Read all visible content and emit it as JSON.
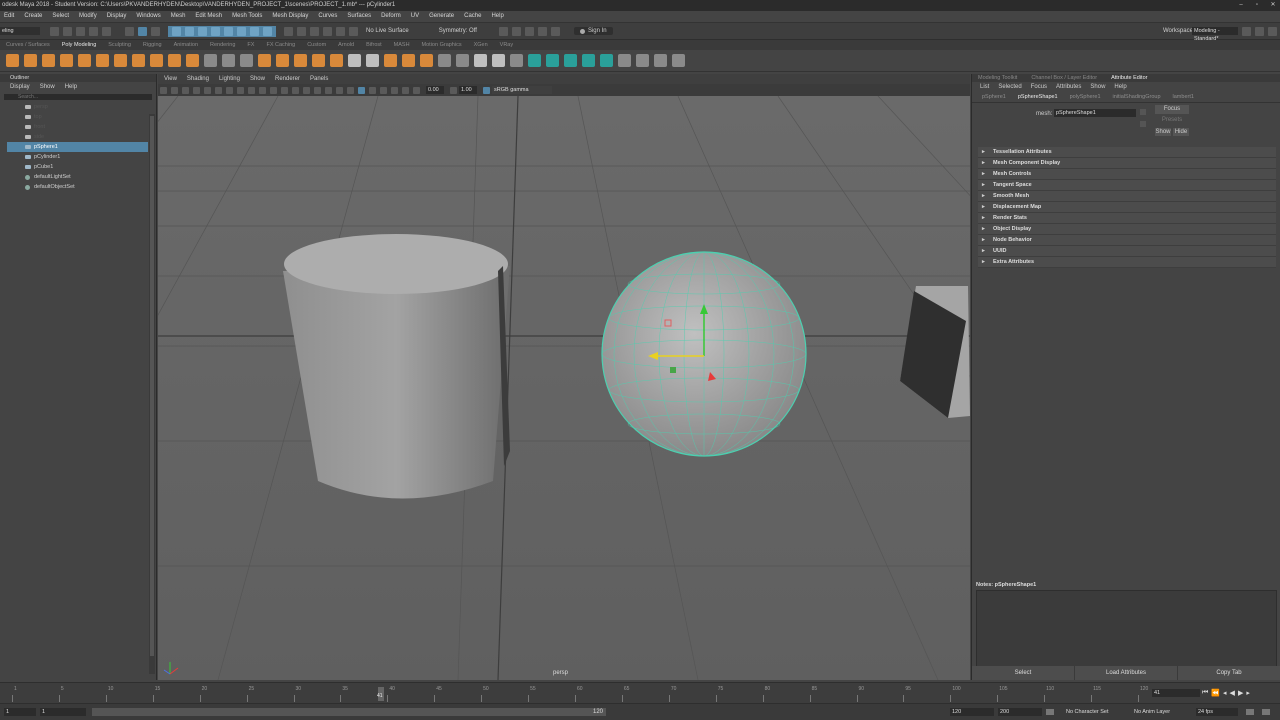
{
  "window": {
    "title": "odesk Maya 2018 - Student Version: C:\\Users\\PKVANDERHYDEN\\Desktop\\VANDERHYDEN_PROJECT_1\\scenes\\PROJECT_1.mb* --- pCylinder1"
  },
  "menubar": [
    "Edit",
    "Create",
    "Select",
    "Modify",
    "Display",
    "Windows",
    "Mesh",
    "Edit Mesh",
    "Mesh Tools",
    "Mesh Display",
    "Curves",
    "Surfaces",
    "Deform",
    "UV",
    "Generate",
    "Cache",
    "Help"
  ],
  "statusline": {
    "mode": "eling",
    "live_surface": "No Live Surface",
    "symmetry": "Symmetry: Off",
    "sign_in": "Sign In",
    "workspace_label": "Workspace:",
    "workspace_value": "Modeling - Standard*"
  },
  "shelf_tabs": [
    "Curves / Surfaces",
    "Poly Modeling",
    "Sculpting",
    "Rigging",
    "Animation",
    "Rendering",
    "FX",
    "FX Caching",
    "Custom",
    "Arnold",
    "Bifrost",
    "MASH",
    "Motion Graphics",
    "XGen",
    "VRay"
  ],
  "shelf_active": "Poly Modeling",
  "outliner": {
    "title": "Outliner",
    "menu": [
      "Display",
      "Show",
      "Help"
    ],
    "search_placeholder": "Search...",
    "items": [
      {
        "label": "persp",
        "type": "camera"
      },
      {
        "label": "top",
        "type": "camera"
      },
      {
        "label": "front",
        "type": "camera"
      },
      {
        "label": "side",
        "type": "camera"
      },
      {
        "label": "pSphere1",
        "type": "mesh",
        "selected": true
      },
      {
        "label": "pCylinder1",
        "type": "mesh"
      },
      {
        "label": "pCube1",
        "type": "mesh"
      },
      {
        "label": "defaultLightSet",
        "type": "set"
      },
      {
        "label": "defaultObjectSet",
        "type": "set"
      }
    ]
  },
  "viewport": {
    "menu": [
      "View",
      "Shading",
      "Lighting",
      "Show",
      "Renderer",
      "Panels"
    ],
    "field1": "0.00",
    "field2": "1.00",
    "color_space": "sRGB gamma",
    "camera_label": "persp"
  },
  "attribute_editor": {
    "top_tabs": [
      "Modeling Toolkit",
      "Channel Box / Layer Editor",
      "Attribute Editor"
    ],
    "active_tab": "Attribute Editor",
    "menu": [
      "List",
      "Selected",
      "Focus",
      "Attributes",
      "Show",
      "Help"
    ],
    "node_tabs": [
      "pSphere1",
      "pSphereShape1",
      "polySphere1",
      "initialShadingGroup",
      "lambert1"
    ],
    "active_node_tab": "pSphereShape1",
    "mesh_label": "mesh:",
    "mesh_value": "pSphereShape1",
    "focus_button": "Focus",
    "presets_button": "Presets",
    "show_button": "Show",
    "hide_button": "Hide",
    "sections": [
      "Tessellation Attributes",
      "Mesh Component Display",
      "Mesh Controls",
      "Tangent Space",
      "Smooth Mesh",
      "Displacement Map",
      "Render Stats",
      "Object Display",
      "Node Behavior",
      "UUID",
      "Extra Attributes"
    ],
    "notes_label": "Notes: pSphereShape1",
    "buttons": [
      "Select",
      "Load Attributes",
      "Copy Tab"
    ]
  },
  "timeline": {
    "ticks": [
      "1",
      "5",
      "10",
      "15",
      "20",
      "25",
      "30",
      "35",
      "40",
      "45",
      "50",
      "55",
      "60",
      "65",
      "70",
      "75",
      "80",
      "85",
      "90",
      "95",
      "100",
      "105",
      "110",
      "115",
      "120"
    ],
    "current_frame": "41",
    "current_field": "41"
  },
  "range": {
    "start": "1",
    "start2": "1",
    "range_end_handle": "120",
    "end": "120",
    "end2": "200",
    "character_set": "No Character Set",
    "anim_layer": "No Anim Layer",
    "fps": "24 fps"
  }
}
